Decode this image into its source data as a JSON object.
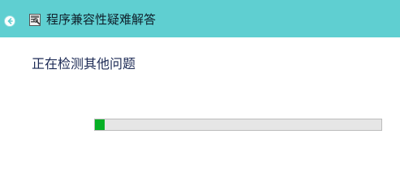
{
  "titlebar": {
    "back_icon": "back-arrow-icon",
    "app_icon": "troubleshooter-icon",
    "title": "程序兼容性疑难解答",
    "background_color": "#5fcfd1"
  },
  "main": {
    "status_text": "正在检测其他问题",
    "progress": {
      "fraction": 0.035,
      "fill_color": "#06b025",
      "track_color": "#e6e6e6"
    }
  }
}
